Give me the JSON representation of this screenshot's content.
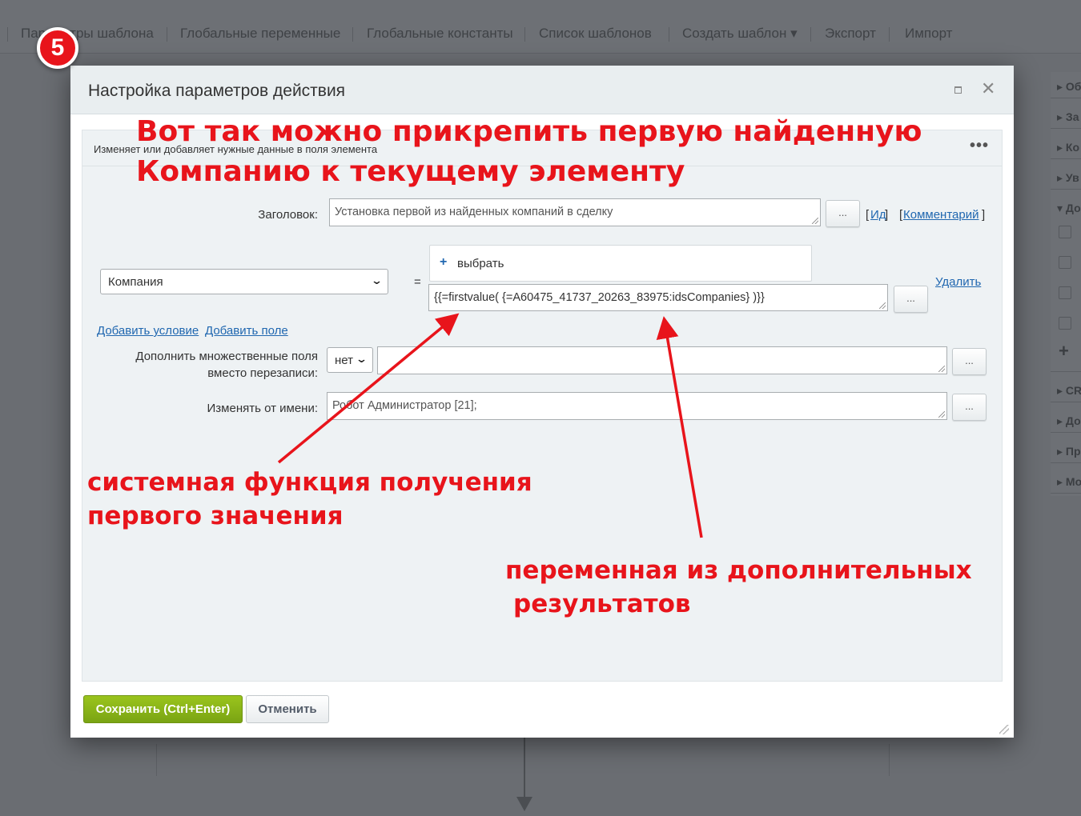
{
  "topmenu": {
    "items": [
      "Параметры шаблона",
      "Глобальные переменные",
      "Глобальные константы",
      "Список шаблонов",
      "Создать шаблон ▾",
      "Экспорт",
      "Импорт"
    ]
  },
  "sidebar_right": {
    "items": [
      "Об",
      "За",
      "Ко",
      "Ув",
      "До",
      "CR",
      "До",
      "Пр",
      "Мо"
    ]
  },
  "step_badge": "5",
  "dialog": {
    "title": "Настройка параметров действия",
    "description": "Изменяет или добавляет нужные данные в поля элемента",
    "header_label": "Заголовок:",
    "header_value": "Установка первой из найденных компаний в сделку",
    "id_link": "Ид",
    "comment_link": "Комментарий",
    "field_select": "Компания",
    "equals": "=",
    "pick_label": "выбрать",
    "expression_value": "{{=firstvalue( {=A60475_41737_20263_83975:idsCompanies} )}}",
    "delete_link": "Удалить",
    "add_condition": "Добавить условие",
    "add_field": "Добавить поле",
    "append_label": "Дополнить множественные поля вместо перезаписи:",
    "append_select": "нет",
    "append_value": "",
    "modify_by_label": "Изменять от имени:",
    "modify_by_value": "Робот Администратор [21];",
    "dots": "...",
    "save_button": "Сохранить (Ctrl+Enter)",
    "cancel_button": "Отменить"
  },
  "annotations": {
    "title_line1": "Вот так можно прикрепить первую найденную",
    "title_line2": "Компанию к текущему элементу",
    "func_line1": "системная функция получения",
    "func_line2": "первого значения",
    "var_line1": "переменная из дополнительных",
    "var_line2": "результатов"
  },
  "colors": {
    "annotation": "#e8141b",
    "save_button": "#8bb61a",
    "link": "#2067b0"
  }
}
